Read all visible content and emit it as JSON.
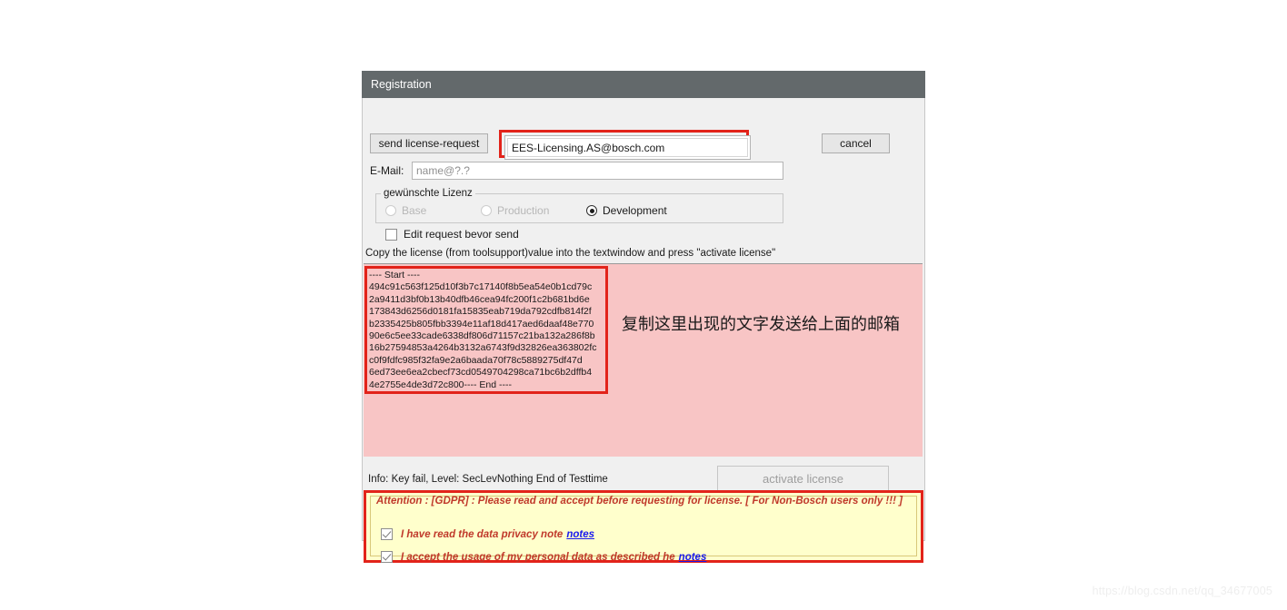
{
  "window": {
    "title": "Registration"
  },
  "toolbar": {
    "send_label": "send license-request",
    "cancel_label": "cancel",
    "recipient_value": "EES-Licensing.AS@bosch.com"
  },
  "email": {
    "label": "E-Mail:",
    "placeholder": "name@?.?",
    "value": ""
  },
  "license_group": {
    "legend": "gewünschte Lizenz",
    "options": [
      {
        "label": "Base",
        "selected": false,
        "enabled": false
      },
      {
        "label": "Production",
        "selected": false,
        "enabled": false
      },
      {
        "label": "Development",
        "selected": true,
        "enabled": true
      }
    ]
  },
  "edit_request": {
    "label": "Edit request bevor send",
    "checked": false
  },
  "copy_hint": "Copy the license (from toolsupport)value into  the textwindow and press \"activate license\"",
  "textwindow": {
    "license_text": "---- Start ----\n494c91c563f125d10f3b7c17140f8b5ea54e0b1cd79c\n2a9411d3bf0b13b40dfb46cea94fc200f1c2b681bd6e\n173843d6256d0181fa15835eab719da792cdfb814f2f\nb2335425b805fbb3394e11af18d417aed6daaf48e770\n90e6c5ee33cade6338df806d71157c21ba132a286f8b\n16b27594853a4264b3132a6743f9d32826ea363802fc\nc0f9fdfc985f32fa9e2a6baada70f78c5889275df47d\n6ed73ee6ea2cbecf73cd0549704298ca71bc6b2dffb4\n4e2755e4de3d72c800---- End ----",
    "annotation_cn": "复制这里出现的文字发送给上面的邮箱"
  },
  "status": {
    "info_text": "Info: Key fail, Level: SecLevNothing End of Testtime",
    "activate_label": "activate license",
    "activate_enabled": false
  },
  "gdpr": {
    "title": "Attention : [GDPR] : Please read and accept before requesting for license. [ For Non-Bosch users only !!! ]",
    "items": [
      {
        "label": "I have read the data privacy note",
        "link": "notes",
        "checked": true
      },
      {
        "label": "I accept the usage of my personal data as described he",
        "link": "notes",
        "checked": true
      }
    ]
  },
  "watermark": "https://blog.csdn.net/qq_34677005",
  "colors": {
    "titlebar": "#63696b",
    "highlight_red": "#e2231a",
    "textwindow_pink": "#f8c5c5",
    "gdpr_yellow": "#ffffcc",
    "gdpr_text": "#c0392b",
    "link_blue": "#1a1aee"
  }
}
